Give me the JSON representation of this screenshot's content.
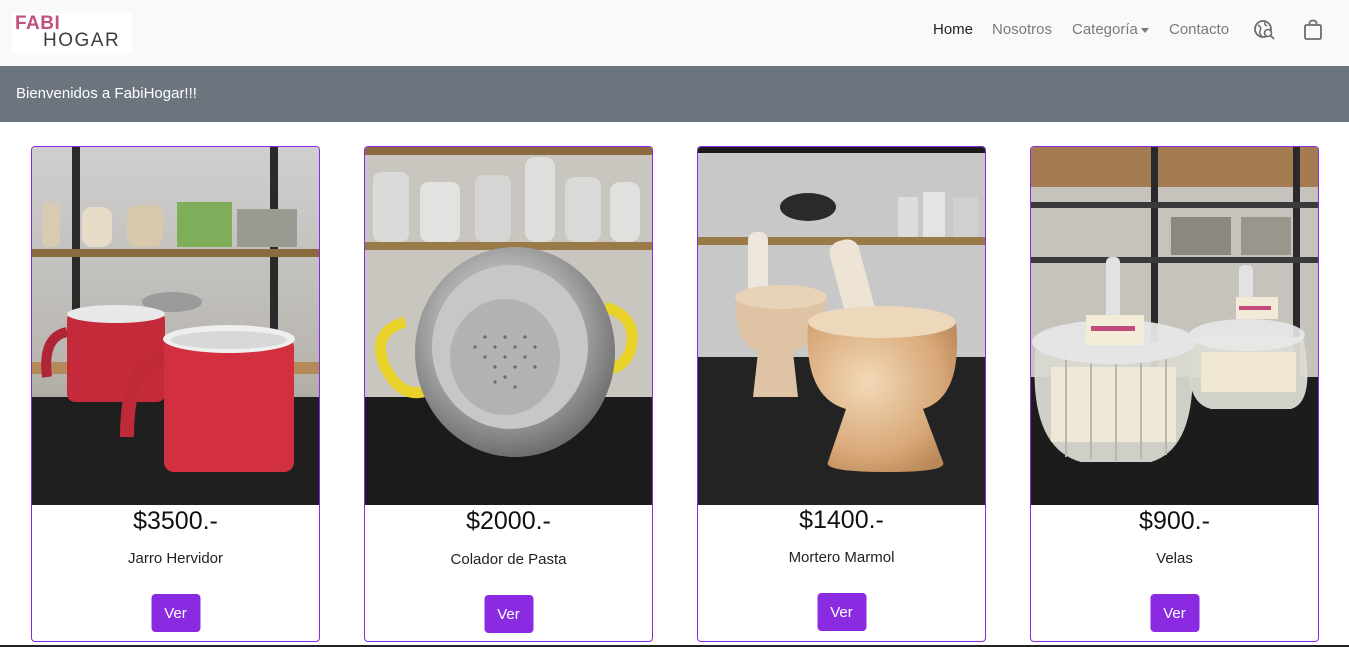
{
  "brand": {
    "line1": "FABI",
    "line2": "HOGAR"
  },
  "nav": {
    "home": "Home",
    "nosotros": "Nosotros",
    "categoria": "Categoría",
    "contacto": "Contacto",
    "search_icon": "globe-search-icon",
    "cart_icon": "shopping-bag-icon"
  },
  "banner": {
    "text": "Bienvenidos a FabiHogar!!!"
  },
  "colors": {
    "accent": "#8a2be2",
    "banner": "#6c757d",
    "navbar": "#f8f9fa",
    "logo_pink": "#c0507f"
  },
  "products": [
    {
      "price": "$3500.-",
      "name": "Jarro Hervidor",
      "button": "Ver"
    },
    {
      "price": "$2000.-",
      "name": "Colador de Pasta",
      "button": "Ver"
    },
    {
      "price": "$1400.-",
      "name": "Mortero Marmol",
      "button": "Ver"
    },
    {
      "price": "$900.-",
      "name": "Velas",
      "button": "Ver"
    }
  ]
}
